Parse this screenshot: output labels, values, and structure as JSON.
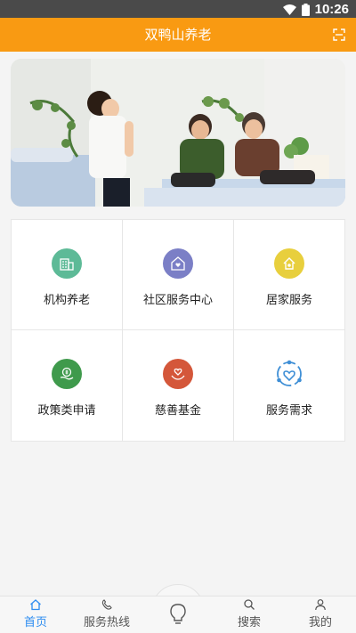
{
  "status_bar": {
    "time": "10:26"
  },
  "header": {
    "title": "双鸭山养老"
  },
  "banner": {
    "alt": ""
  },
  "services": [
    {
      "label": "机构养老",
      "icon": "building-icon",
      "color": "#5dba97"
    },
    {
      "label": "社区服务中心",
      "icon": "house-heart-icon",
      "color": "#7b7fc6"
    },
    {
      "label": "居家服务",
      "icon": "home-care-icon",
      "color": "#e8cf3d"
    },
    {
      "label": "政策类申请",
      "icon": "money-hand-icon",
      "color": "#3f9a4c"
    },
    {
      "label": "慈善基金",
      "icon": "charity-heart-icon",
      "color": "#d4573a"
    },
    {
      "label": "服务需求",
      "icon": "service-heart-icon",
      "color": "#3f8fd6"
    }
  ],
  "tabbar": {
    "tabs": [
      {
        "label": "首页",
        "icon": "home-icon",
        "active": true
      },
      {
        "label": "服务热线",
        "icon": "phone-icon",
        "active": false
      },
      {
        "label": "",
        "icon": "lightbulb-icon",
        "active": false
      },
      {
        "label": "搜索",
        "icon": "search-icon",
        "active": false
      },
      {
        "label": "我的",
        "icon": "user-icon",
        "active": false
      }
    ]
  }
}
